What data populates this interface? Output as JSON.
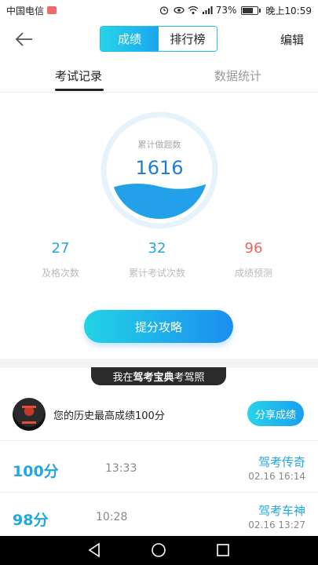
{
  "status_bar": {
    "carrier": "中国电信",
    "battery_percent": "73%",
    "time": "晚上10:59",
    "battery_level": 0.73,
    "icons": [
      "alarm-icon",
      "eye-icon",
      "wifi-icon",
      "signal-icon",
      "battery-icon"
    ]
  },
  "header": {
    "segments": [
      "成绩",
      "排行榜"
    ],
    "active_segment": "成绩",
    "edit_label": "编辑",
    "back_icon": "back-arrow-icon"
  },
  "tabs": [
    {
      "label": "考试记录",
      "active": true
    },
    {
      "label": "数据统计",
      "active": false
    }
  ],
  "progress_circle": {
    "label": "累计做题数",
    "value": "1616",
    "fill_fraction": 0.35
  },
  "stats": [
    {
      "value": "27",
      "label": "及格次数",
      "color": "#22a7e0"
    },
    {
      "value": "32",
      "label": "累计考试次数",
      "color": "#22a7e0"
    },
    {
      "value": "96",
      "label": "成绩预测",
      "color": "#e26767"
    }
  ],
  "cta_label": "提分攻略",
  "promo": {
    "prefix": "我在",
    "brand": "驾考宝典",
    "suffix": "考驾照"
  },
  "history": {
    "text": "您的历史最高成绩100分",
    "share_label": "分享成绩"
  },
  "records": [
    {
      "score": "100分",
      "duration": "13:33",
      "title": "驾考传奇",
      "time": "02.16  16:14"
    },
    {
      "score": "98分",
      "duration": "10:28",
      "title": "驾考车神",
      "time": "02.16  13:27"
    }
  ],
  "colors": {
    "accent": "#22a7e0",
    "gradient_start": "#27d4e8",
    "gradient_end": "#1a9ef0",
    "warning": "#e26767"
  }
}
